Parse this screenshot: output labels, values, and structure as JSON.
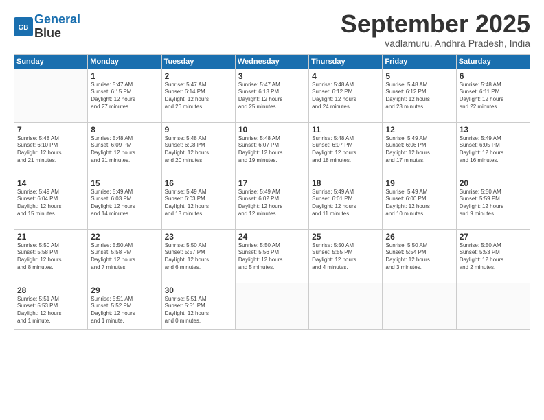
{
  "header": {
    "logo": "GeneralBlue",
    "title": "September 2025",
    "subtitle": "vadlamuru, Andhra Pradesh, India"
  },
  "days_of_week": [
    "Sunday",
    "Monday",
    "Tuesday",
    "Wednesday",
    "Thursday",
    "Friday",
    "Saturday"
  ],
  "weeks": [
    [
      {
        "day": "",
        "info": ""
      },
      {
        "day": "1",
        "info": "Sunrise: 5:47 AM\nSunset: 6:15 PM\nDaylight: 12 hours\nand 27 minutes."
      },
      {
        "day": "2",
        "info": "Sunrise: 5:47 AM\nSunset: 6:14 PM\nDaylight: 12 hours\nand 26 minutes."
      },
      {
        "day": "3",
        "info": "Sunrise: 5:47 AM\nSunset: 6:13 PM\nDaylight: 12 hours\nand 25 minutes."
      },
      {
        "day": "4",
        "info": "Sunrise: 5:48 AM\nSunset: 6:12 PM\nDaylight: 12 hours\nand 24 minutes."
      },
      {
        "day": "5",
        "info": "Sunrise: 5:48 AM\nSunset: 6:12 PM\nDaylight: 12 hours\nand 23 minutes."
      },
      {
        "day": "6",
        "info": "Sunrise: 5:48 AM\nSunset: 6:11 PM\nDaylight: 12 hours\nand 22 minutes."
      }
    ],
    [
      {
        "day": "7",
        "info": "Sunrise: 5:48 AM\nSunset: 6:10 PM\nDaylight: 12 hours\nand 21 minutes."
      },
      {
        "day": "8",
        "info": "Sunrise: 5:48 AM\nSunset: 6:09 PM\nDaylight: 12 hours\nand 21 minutes."
      },
      {
        "day": "9",
        "info": "Sunrise: 5:48 AM\nSunset: 6:08 PM\nDaylight: 12 hours\nand 20 minutes."
      },
      {
        "day": "10",
        "info": "Sunrise: 5:48 AM\nSunset: 6:07 PM\nDaylight: 12 hours\nand 19 minutes."
      },
      {
        "day": "11",
        "info": "Sunrise: 5:48 AM\nSunset: 6:07 PM\nDaylight: 12 hours\nand 18 minutes."
      },
      {
        "day": "12",
        "info": "Sunrise: 5:49 AM\nSunset: 6:06 PM\nDaylight: 12 hours\nand 17 minutes."
      },
      {
        "day": "13",
        "info": "Sunrise: 5:49 AM\nSunset: 6:05 PM\nDaylight: 12 hours\nand 16 minutes."
      }
    ],
    [
      {
        "day": "14",
        "info": "Sunrise: 5:49 AM\nSunset: 6:04 PM\nDaylight: 12 hours\nand 15 minutes."
      },
      {
        "day": "15",
        "info": "Sunrise: 5:49 AM\nSunset: 6:03 PM\nDaylight: 12 hours\nand 14 minutes."
      },
      {
        "day": "16",
        "info": "Sunrise: 5:49 AM\nSunset: 6:03 PM\nDaylight: 12 hours\nand 13 minutes."
      },
      {
        "day": "17",
        "info": "Sunrise: 5:49 AM\nSunset: 6:02 PM\nDaylight: 12 hours\nand 12 minutes."
      },
      {
        "day": "18",
        "info": "Sunrise: 5:49 AM\nSunset: 6:01 PM\nDaylight: 12 hours\nand 11 minutes."
      },
      {
        "day": "19",
        "info": "Sunrise: 5:49 AM\nSunset: 6:00 PM\nDaylight: 12 hours\nand 10 minutes."
      },
      {
        "day": "20",
        "info": "Sunrise: 5:50 AM\nSunset: 5:59 PM\nDaylight: 12 hours\nand 9 minutes."
      }
    ],
    [
      {
        "day": "21",
        "info": "Sunrise: 5:50 AM\nSunset: 5:58 PM\nDaylight: 12 hours\nand 8 minutes."
      },
      {
        "day": "22",
        "info": "Sunrise: 5:50 AM\nSunset: 5:58 PM\nDaylight: 12 hours\nand 7 minutes."
      },
      {
        "day": "23",
        "info": "Sunrise: 5:50 AM\nSunset: 5:57 PM\nDaylight: 12 hours\nand 6 minutes."
      },
      {
        "day": "24",
        "info": "Sunrise: 5:50 AM\nSunset: 5:56 PM\nDaylight: 12 hours\nand 5 minutes."
      },
      {
        "day": "25",
        "info": "Sunrise: 5:50 AM\nSunset: 5:55 PM\nDaylight: 12 hours\nand 4 minutes."
      },
      {
        "day": "26",
        "info": "Sunrise: 5:50 AM\nSunset: 5:54 PM\nDaylight: 12 hours\nand 3 minutes."
      },
      {
        "day": "27",
        "info": "Sunrise: 5:50 AM\nSunset: 5:53 PM\nDaylight: 12 hours\nand 2 minutes."
      }
    ],
    [
      {
        "day": "28",
        "info": "Sunrise: 5:51 AM\nSunset: 5:53 PM\nDaylight: 12 hours\nand 1 minute."
      },
      {
        "day": "29",
        "info": "Sunrise: 5:51 AM\nSunset: 5:52 PM\nDaylight: 12 hours\nand 1 minute."
      },
      {
        "day": "30",
        "info": "Sunrise: 5:51 AM\nSunset: 5:51 PM\nDaylight: 12 hours\nand 0 minutes."
      },
      {
        "day": "",
        "info": ""
      },
      {
        "day": "",
        "info": ""
      },
      {
        "day": "",
        "info": ""
      },
      {
        "day": "",
        "info": ""
      }
    ]
  ]
}
